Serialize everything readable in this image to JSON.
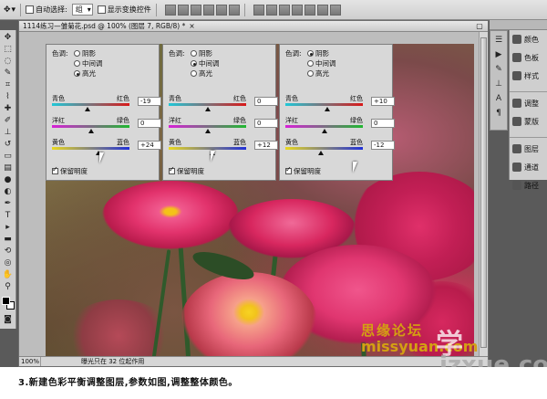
{
  "options_bar": {
    "auto_select_label": "自动选择:",
    "auto_select_value": "组",
    "show_transform_label": "显示变换控件"
  },
  "document": {
    "title": "1114练习—雏菊花.psd @ 100% (图层 7, RGB/8) *",
    "close_label": "×",
    "zoom": "100%",
    "status": "曝光只在 32 位起作用"
  },
  "panels": [
    {
      "tone_label": "色调:",
      "tones": [
        "阴影",
        "中间调",
        "高光"
      ],
      "selected_tone": 2,
      "sliders": [
        {
          "left": "青色",
          "right": "红色",
          "value": "-19"
        },
        {
          "left": "洋红",
          "right": "绿色",
          "value": "0"
        },
        {
          "left": "黄色",
          "right": "蓝色",
          "value": "+24"
        }
      ],
      "preserve_label": "保留明度"
    },
    {
      "tone_label": "色调:",
      "tones": [
        "阴影",
        "中间调",
        "高光"
      ],
      "selected_tone": 1,
      "sliders": [
        {
          "left": "青色",
          "right": "红色",
          "value": "0"
        },
        {
          "left": "洋红",
          "right": "绿色",
          "value": "0"
        },
        {
          "left": "黄色",
          "right": "蓝色",
          "value": "+12"
        }
      ],
      "preserve_label": "保留明度"
    },
    {
      "tone_label": "色调:",
      "tones": [
        "阴影",
        "中间调",
        "高光"
      ],
      "selected_tone": 0,
      "sliders": [
        {
          "left": "青色",
          "right": "红色",
          "value": "+10"
        },
        {
          "left": "洋红",
          "right": "绿色",
          "value": "0"
        },
        {
          "left": "黄色",
          "right": "蓝色",
          "value": "-12"
        }
      ],
      "preserve_label": "保留明度"
    }
  ],
  "dock": {
    "items": [
      "颜色",
      "色板",
      "样式",
      "调整",
      "蒙版",
      "图层",
      "通道",
      "路径"
    ]
  },
  "caption": "3.新建色彩平衡调整图层,参数如图,调整整体颜色。",
  "watermarks": {
    "forum": "思缘论坛",
    "site": "missyuan.com",
    "brand": "学",
    "domain": "jzxue.com"
  },
  "colors": {
    "accent_gold": "#d4a012"
  }
}
